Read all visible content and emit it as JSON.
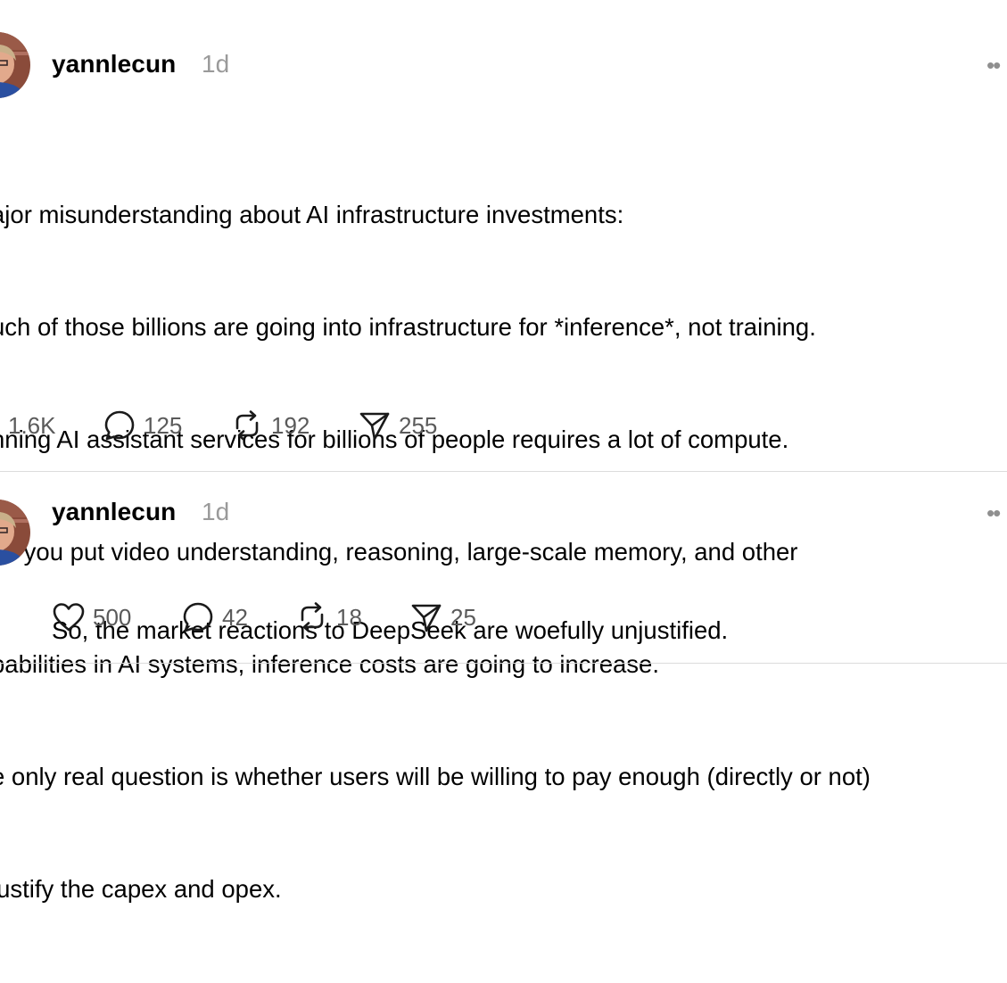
{
  "posts": [
    {
      "username": "yannlecun",
      "time": "1d",
      "more_label": "••",
      "lines": [
        "ajor misunderstanding about AI infrastructure investments:",
        "uch of those billions are going into infrastructure for *inference*, not training.",
        "nning AI assistant services for billions of people requires a lot of compute.",
        "ce you put video understanding, reasoning, large-scale memory, and other",
        "pabilities in AI systems, inference costs are going to increase.",
        "e only real question is whether users will be willing to pay enough (directly or not)",
        "justify the capex and opex."
      ],
      "actions": {
        "likes": "1.6K",
        "replies": "125",
        "reposts": "192",
        "shares": "255"
      }
    },
    {
      "username": "yannlecun",
      "time": "1d",
      "more_label": "••",
      "lines": [
        "So, the market reactions to DeepSeek are woefully unjustified."
      ],
      "actions": {
        "likes": "500",
        "replies": "42",
        "reposts": "18",
        "shares": "25"
      }
    }
  ],
  "icons": {
    "like": "heart-icon",
    "reply": "speech-bubble-icon",
    "repost": "repost-arrows-icon",
    "share": "paper-plane-icon",
    "more": "more-dots-icon"
  },
  "colors": {
    "text": "#000000",
    "muted": "#9a9a9a",
    "count": "#5a5a5a",
    "divider": "#dcdcdc"
  }
}
